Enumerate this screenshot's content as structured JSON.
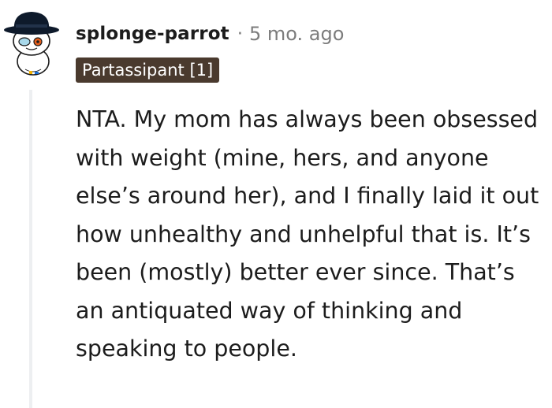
{
  "comment": {
    "username": "splonge-parrot",
    "separator": "·",
    "timestamp": "5 mo. ago",
    "flair": "Partassipant [1]",
    "body": "NTA. My mom has always been obsessed with weight (mine, hers, and anyone else’s around her), and I finally laid it out how unhealthy and unhelpful that is. It’s been (mostly) better ever since. That’s an antiquated way of thinking and speaking to people."
  },
  "colors": {
    "flair_bg": "#4a3a2e",
    "hat": "#0e1a2b",
    "text_muted": "#7c7c7c",
    "thread_line": "#edeff1"
  },
  "icons": {
    "avatar": "snoo-avatar-with-hat"
  }
}
